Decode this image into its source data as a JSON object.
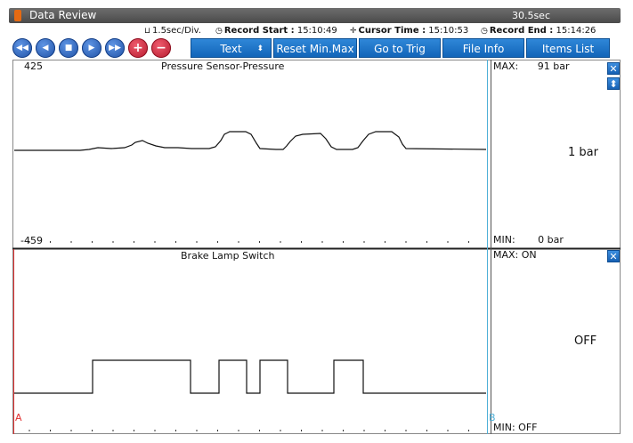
{
  "window": {
    "title": "Data Review",
    "elapsed": "30.5sec"
  },
  "info": {
    "time_div": "1.5sec/Div.",
    "record_start_label": "Record Start :",
    "record_start": "15:10:49",
    "cursor_time_label": "Cursor Time :",
    "cursor_time": "15:10:53",
    "record_end_label": "Record End :",
    "record_end": "15:14:26"
  },
  "toolbar": {
    "nav_buttons": [
      "rewind-icon",
      "prev-icon",
      "stop-icon",
      "play-icon",
      "fast-forward-icon"
    ],
    "zoom_in_icon": "plus-icon",
    "zoom_out_icon": "minus-icon",
    "text_select_value": "Text",
    "reset_label": "Reset Min.Max",
    "goto_trig_label": "Go to Trig",
    "file_info_label": "File Info",
    "items_list_label": "Items List"
  },
  "panel1": {
    "title": "Pressure Sensor-Pressure",
    "scale_max": "425",
    "scale_min": "-459",
    "max_label": "MAX:",
    "max_value": "91 bar",
    "min_label": "MIN:",
    "min_value": "0 bar",
    "current_value": "1 bar"
  },
  "panel2": {
    "title": "Brake Lamp Switch",
    "max_label": "MAX:",
    "max_value": "ON",
    "min_label": "MIN:",
    "min_value": "OFF",
    "current_value": "OFF",
    "cursor_a": "A",
    "cursor_b": "B"
  },
  "colors": {
    "accent": "#1a6cc4",
    "trace": "#111111",
    "cursor_a": "#e03030",
    "cursor_b": "#4fb0d8"
  }
}
